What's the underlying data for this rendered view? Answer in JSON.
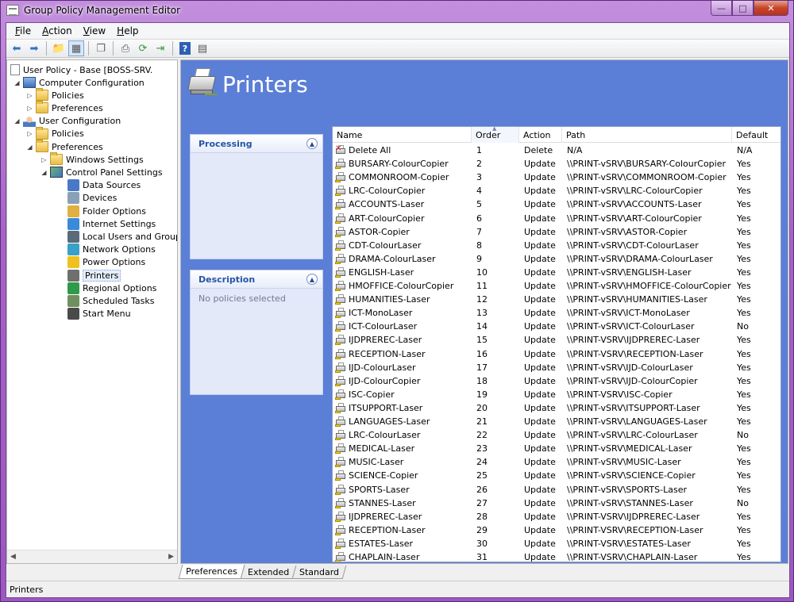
{
  "window": {
    "title": "Group Policy Management Editor",
    "controls": [
      "minimize",
      "maximize",
      "close"
    ]
  },
  "menu": [
    {
      "label": "File",
      "accel": "F",
      "rest": "ile"
    },
    {
      "label": "Action",
      "accel": "A",
      "rest": "ction"
    },
    {
      "label": "View",
      "accel": "V",
      "rest": "iew"
    },
    {
      "label": "Help",
      "accel": "H",
      "rest": "elp"
    }
  ],
  "toolbar": {
    "icons": [
      "back-icon",
      "forward-icon",
      "up-folder-icon",
      "show-hide-tree-icon",
      "copy-icon",
      "print-icon",
      "refresh-icon",
      "export-icon",
      "help-icon",
      "properties-icon"
    ]
  },
  "tree": {
    "root": "User Policy - Base [BOSS-SRV.",
    "items": [
      {
        "label": "Computer Configuration",
        "level": 1
      },
      {
        "label": "Policies",
        "level": 2
      },
      {
        "label": "Preferences",
        "level": 2
      },
      {
        "label": "User Configuration",
        "level": 1
      },
      {
        "label": "Policies",
        "level": 2
      },
      {
        "label": "Preferences",
        "level": 2
      },
      {
        "label": "Windows Settings",
        "level": 3
      },
      {
        "label": "Control Panel Settings",
        "level": 3
      },
      {
        "label": "Data Sources",
        "level": 4
      },
      {
        "label": "Devices",
        "level": 4
      },
      {
        "label": "Folder Options",
        "level": 4
      },
      {
        "label": "Internet Settings",
        "level": 4
      },
      {
        "label": "Local Users and Groups",
        "level": 4
      },
      {
        "label": "Network Options",
        "level": 4
      },
      {
        "label": "Power Options",
        "level": 4
      },
      {
        "label": "Printers",
        "level": 4
      },
      {
        "label": "Regional Options",
        "level": 4
      },
      {
        "label": "Scheduled Tasks",
        "level": 4
      },
      {
        "label": "Start Menu",
        "level": 4
      }
    ],
    "selected": "Printers"
  },
  "main": {
    "title": "Printers",
    "processing_panel": {
      "title": "Processing"
    },
    "description_panel": {
      "title": "Description",
      "text": "No policies selected"
    },
    "columns": [
      "Name",
      "Order",
      "Action",
      "Path",
      "Default"
    ],
    "sorted_column": "Order",
    "rows": [
      [
        "Delete All",
        "1",
        "Delete",
        "N/A",
        "N/A"
      ],
      [
        "BURSARY-ColourCopier",
        "2",
        "Update",
        "\\\\PRINT-vSRV\\BURSARY-ColourCopier",
        "Yes"
      ],
      [
        "COMMONROOM-Copier",
        "3",
        "Update",
        "\\\\PRINT-vSRV\\COMMONROOM-Copier",
        "Yes"
      ],
      [
        "LRC-ColourCopier",
        "4",
        "Update",
        "\\\\PRINT-vSRV\\LRC-ColourCopier",
        "Yes"
      ],
      [
        "ACCOUNTS-Laser",
        "5",
        "Update",
        "\\\\PRINT-vSRV\\ACCOUNTS-Laser",
        "Yes"
      ],
      [
        "ART-ColourCopier",
        "6",
        "Update",
        "\\\\PRINT-vSRV\\ART-ColourCopier",
        "Yes"
      ],
      [
        "ASTOR-Copier",
        "7",
        "Update",
        "\\\\PRINT-vSRV\\ASTOR-Copier",
        "Yes"
      ],
      [
        "CDT-ColourLaser",
        "8",
        "Update",
        "\\\\PRINT-vSRV\\CDT-ColourLaser",
        "Yes"
      ],
      [
        "DRAMA-ColourLaser",
        "9",
        "Update",
        "\\\\PRINT-vSRV\\DRAMA-ColourLaser",
        "Yes"
      ],
      [
        "ENGLISH-Laser",
        "10",
        "Update",
        "\\\\PRINT-vSRV\\ENGLISH-Laser",
        "Yes"
      ],
      [
        "HMOFFICE-ColourCopier",
        "11",
        "Update",
        "\\\\PRINT-vSRV\\HMOFFICE-ColourCopier",
        "Yes"
      ],
      [
        "HUMANITIES-Laser",
        "12",
        "Update",
        "\\\\PRINT-vSRV\\HUMANITIES-Laser",
        "Yes"
      ],
      [
        "ICT-MonoLaser",
        "13",
        "Update",
        "\\\\PRINT-vSRV\\ICT-MonoLaser",
        "Yes"
      ],
      [
        "ICT-ColourLaser",
        "14",
        "Update",
        "\\\\PRINT-vSRV\\ICT-ColourLaser",
        "No"
      ],
      [
        "IJDPREREC-Laser",
        "15",
        "Update",
        "\\\\PRINT-VSRV\\IJDPREREC-Laser",
        "Yes"
      ],
      [
        "RECEPTION-Laser",
        "16",
        "Update",
        "\\\\PRINT-VSRV\\RECEPTION-Laser",
        "Yes"
      ],
      [
        "IJD-ColourLaser",
        "17",
        "Update",
        "\\\\PRINT-vSRV\\IJD-ColourLaser",
        "Yes"
      ],
      [
        "IJD-ColourCopier",
        "18",
        "Update",
        "\\\\PRINT-vSRV\\IJD-ColourCopier",
        "Yes"
      ],
      [
        "ISC-Copier",
        "19",
        "Update",
        "\\\\PRINT-VSRV\\ISC-Copier",
        "Yes"
      ],
      [
        "ITSUPPORT-Laser",
        "20",
        "Update",
        "\\\\PRINT-vSRV\\ITSUPPORT-Laser",
        "Yes"
      ],
      [
        "LANGUAGES-Laser",
        "21",
        "Update",
        "\\\\PRINT-vSRV\\LANGUAGES-Laser",
        "Yes"
      ],
      [
        "LRC-ColourLaser",
        "22",
        "Update",
        "\\\\PRINT-vSRV\\LRC-ColourLaser",
        "No"
      ],
      [
        "MEDICAL-Laser",
        "23",
        "Update",
        "\\\\PRINT-vSRV\\MEDICAL-Laser",
        "Yes"
      ],
      [
        "MUSIC-Laser",
        "24",
        "Update",
        "\\\\PRINT-vSRV\\MUSIC-Laser",
        "Yes"
      ],
      [
        "SCIENCE-Copier",
        "25",
        "Update",
        "\\\\PRINT-vSRV\\SCIENCE-Copier",
        "Yes"
      ],
      [
        "SPORTS-Laser",
        "26",
        "Update",
        "\\\\PRINT-vSRV\\SPORTS-Laser",
        "Yes"
      ],
      [
        "STANNES-Laser",
        "27",
        "Update",
        "\\\\PRINT-vSRV\\STANNES-Laser",
        "No"
      ],
      [
        "IJDPREREC-Laser",
        "28",
        "Update",
        "\\\\PRINT-VSRV\\IJDPREREC-Laser",
        "Yes"
      ],
      [
        "RECEPTION-Laser",
        "29",
        "Update",
        "\\\\PRINT-VSRV\\RECEPTION-Laser",
        "Yes"
      ],
      [
        "ESTATES-Laser",
        "30",
        "Update",
        "\\\\PRINT-VSRV\\ESTATES-Laser",
        "Yes"
      ],
      [
        "CHAPLAIN-Laser",
        "31",
        "Update",
        "\\\\PRINT-VSRV\\CHAPLAIN-Laser",
        "Yes"
      ]
    ]
  },
  "tabs": [
    "Preferences",
    "Extended",
    "Standard"
  ],
  "active_tab": "Preferences",
  "status": "Printers",
  "colors": {
    "frame": "#a562c8",
    "panel_bg": "#5b7fd6",
    "panel_title": "#2654a6"
  }
}
